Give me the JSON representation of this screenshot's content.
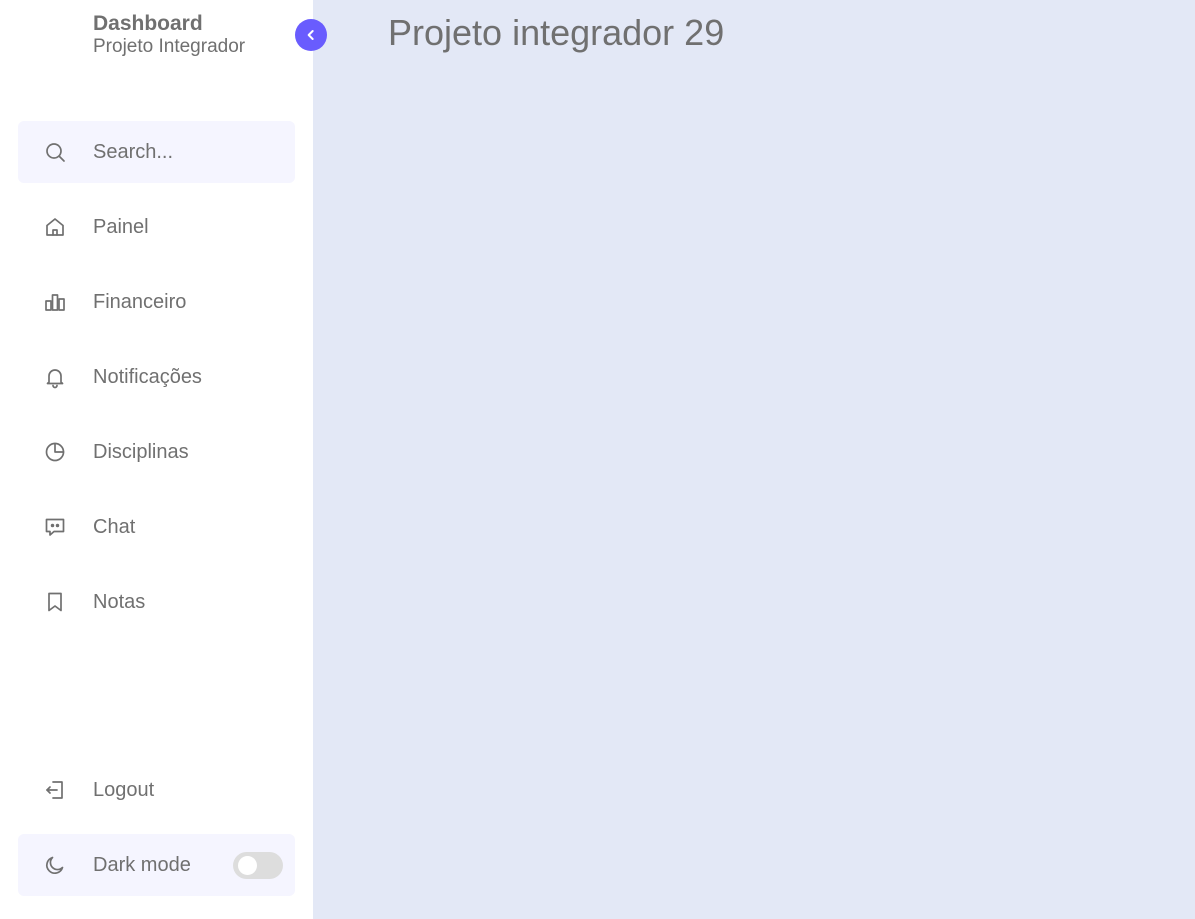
{
  "brand": {
    "title": "Dashboard",
    "subtitle": "Projeto Integrador"
  },
  "sidebar": {
    "collapse_icon": "chevron-left-icon",
    "search": {
      "placeholder": "Search...",
      "value": "",
      "icon": "search-icon"
    },
    "items": [
      {
        "label": "Painel",
        "icon": "home-icon"
      },
      {
        "label": "Financeiro",
        "icon": "bar-chart-icon"
      },
      {
        "label": "Notificações",
        "icon": "bell-icon"
      },
      {
        "label": "Disciplinas",
        "icon": "pie-chart-icon"
      },
      {
        "label": "Chat",
        "icon": "chat-icon"
      },
      {
        "label": "Notas",
        "icon": "bookmark-icon"
      }
    ],
    "logout": {
      "label": "Logout",
      "icon": "logout-icon"
    },
    "dark_mode": {
      "label": "Dark mode",
      "icon": "moon-icon",
      "enabled": false
    }
  },
  "main": {
    "title": "Projeto integrador 29"
  },
  "colors": {
    "accent": "#695cfe",
    "sidebar_bg": "#ffffff",
    "main_bg": "#e3e8f6",
    "text": "#707070",
    "highlight_bg": "#f5f5ff"
  }
}
